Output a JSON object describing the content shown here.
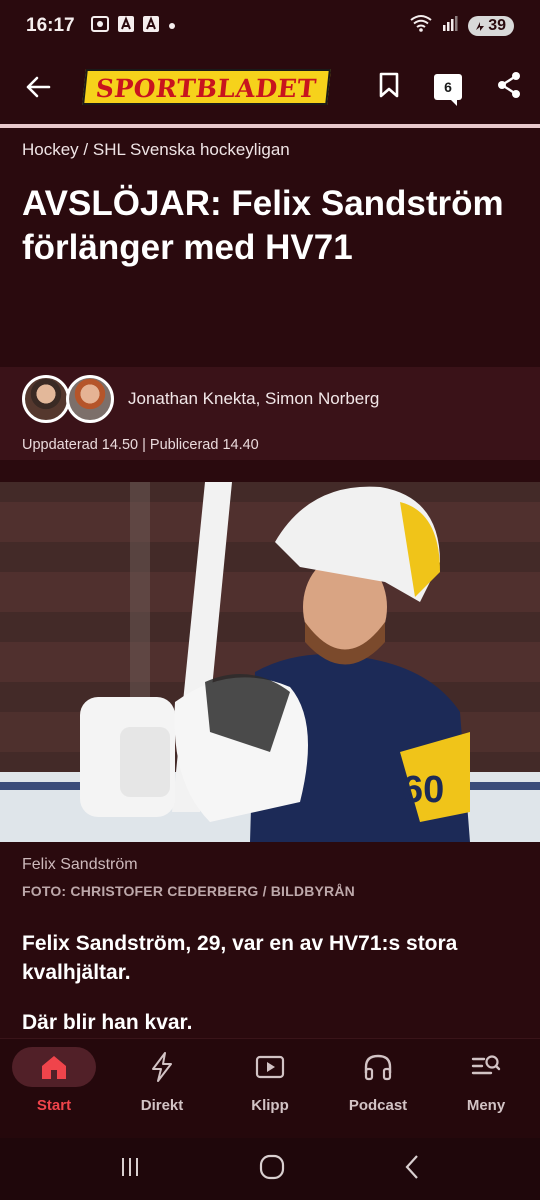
{
  "status_bar": {
    "time": "16:17",
    "battery": "39",
    "icons": [
      "screenshot-icon",
      "font-icon",
      "font-icon",
      "dot-icon",
      "wifi-icon",
      "signal-icon",
      "battery-icon"
    ]
  },
  "app_bar": {
    "logo_text": "SPORTBLADET",
    "comment_count": "6"
  },
  "article": {
    "breadcrumb": "Hockey / SHL Svenska hockeyligan",
    "headline": "AVSLÖJAR: Felix Sandström förlänger med HV71",
    "authors": "Jonathan Knekta, Simon Norberg",
    "updated": "Uppdaterad 14.50 | Publicerad 14.40",
    "image_caption": "Felix Sandström",
    "photo_credit": "FOTO: CHRISTOFER CEDERBERG / BILDBYRÅN",
    "lead_1": "Felix Sandström, 29, var en av HV71:s stora kvalhjältar.",
    "lead_2": "Där blir han kvar."
  },
  "bottom_nav": {
    "items": [
      {
        "label": "Start",
        "icon": "home-icon",
        "active": true
      },
      {
        "label": "Direkt",
        "icon": "lightning-icon",
        "active": false
      },
      {
        "label": "Klipp",
        "icon": "play-icon",
        "active": false
      },
      {
        "label": "Podcast",
        "icon": "headphones-icon",
        "active": false
      },
      {
        "label": "Meny",
        "icon": "menu-search-icon",
        "active": false
      }
    ]
  },
  "colors": {
    "background": "#2a0a0e",
    "accent": "#f0444b",
    "logo_yellow": "#f6d21b",
    "logo_red": "#c8141e"
  }
}
